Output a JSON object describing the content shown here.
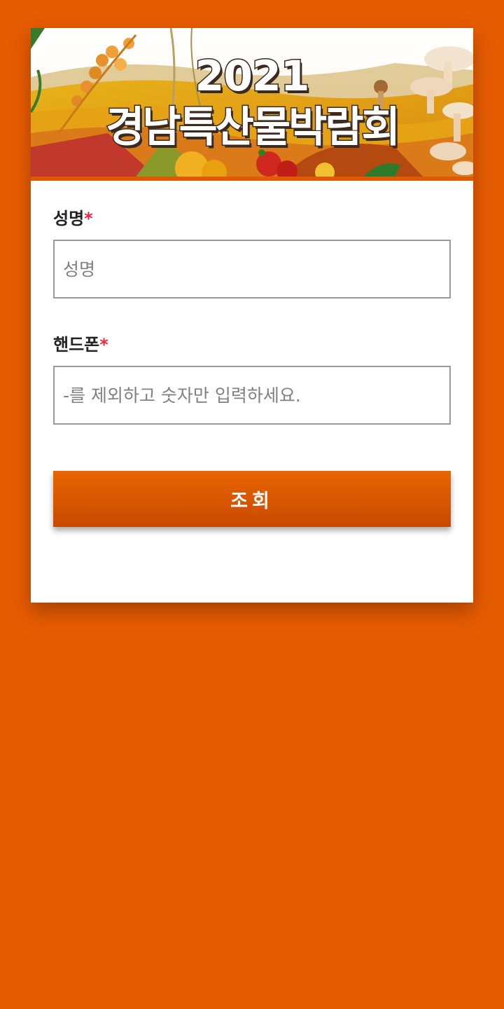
{
  "banner": {
    "year": "2021",
    "title": "경남특산물박람회"
  },
  "form": {
    "name_label": "성명",
    "name_placeholder": "성명",
    "name_value": "",
    "phone_label": "핸드폰",
    "phone_placeholder": "-를 제외하고 숫자만 입력하세요.",
    "phone_value": "",
    "required_mark": "*",
    "submit_label": "조회"
  },
  "colors": {
    "background": "#e65c00",
    "card": "#ffffff",
    "button_top": "#e86500",
    "button_bottom": "#c84a00",
    "required": "#ff1e3c"
  }
}
